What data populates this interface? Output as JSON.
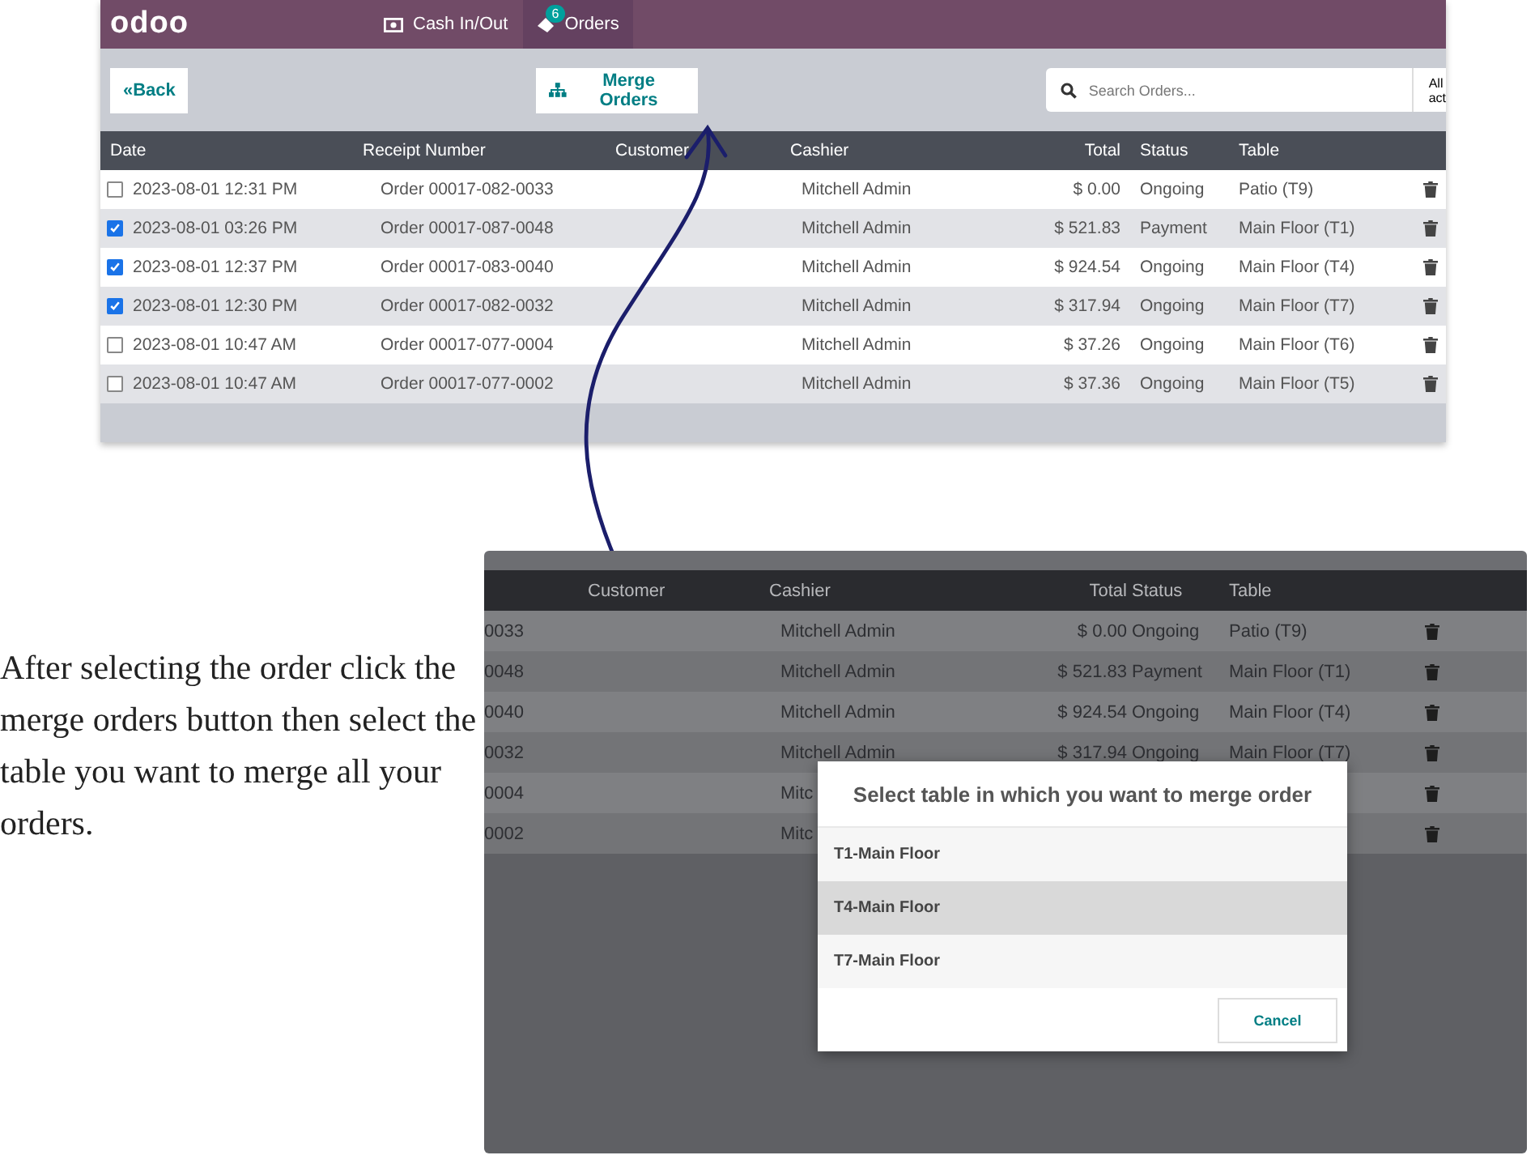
{
  "top_screenshot": {
    "brand": "odoo",
    "tabs": [
      {
        "kind": "cash",
        "label": "Cash In/Out",
        "selected": false
      },
      {
        "kind": "orders",
        "label": "Orders",
        "badge": "6",
        "selected": true
      }
    ],
    "back_button": {
      "icon": "«",
      "label": "Back"
    },
    "merge_button": "Merge Orders",
    "search": {
      "placeholder": "Search Orders...",
      "filter": "All act"
    },
    "columns": [
      "Date",
      "Receipt Number",
      "Customer",
      "Cashier",
      "Total",
      "Status",
      "Table"
    ],
    "rows": [
      {
        "checked": false,
        "date": "2023-08-01 12:31 PM",
        "receipt": "Order 00017-082-0033",
        "cashier": "Mitchell Admin",
        "total": "$ 0.00",
        "status": "Ongoing",
        "table": "Patio (T9)"
      },
      {
        "checked": true,
        "date": "2023-08-01 03:26 PM",
        "receipt": "Order 00017-087-0048",
        "cashier": "Mitchell Admin",
        "total": "$ 521.83",
        "status": "Payment",
        "table": "Main Floor (T1)"
      },
      {
        "checked": true,
        "date": "2023-08-01 12:37 PM",
        "receipt": "Order 00017-083-0040",
        "cashier": "Mitchell Admin",
        "total": "$ 924.54",
        "status": "Ongoing",
        "table": "Main Floor (T4)"
      },
      {
        "checked": true,
        "date": "2023-08-01 12:30 PM",
        "receipt": "Order 00017-082-0032",
        "cashier": "Mitchell Admin",
        "total": "$ 317.94",
        "status": "Ongoing",
        "table": "Main Floor (T7)"
      },
      {
        "checked": false,
        "date": "2023-08-01 10:47 AM",
        "receipt": "Order 00017-077-0004",
        "cashier": "Mitchell Admin",
        "total": "$ 37.26",
        "status": "Ongoing",
        "table": "Main Floor (T6)"
      },
      {
        "checked": false,
        "date": "2023-08-01 10:47 AM",
        "receipt": "Order 00017-077-0002",
        "cashier": "Mitchell Admin",
        "total": "$ 37.36",
        "status": "Ongoing",
        "table": "Main Floor (T5)"
      }
    ]
  },
  "caption": "After selecting the order click the merge orders button then select the table you want to merge all your orders.",
  "bottom_screenshot": {
    "columns": [
      "Customer",
      "Cashier",
      "Total",
      "Status",
      "Table"
    ],
    "rows": [
      {
        "receipt": "0033",
        "cashier": "Mitchell Admin",
        "total": "$ 0.00",
        "status": "Ongoing",
        "table": "Patio (T9)"
      },
      {
        "receipt": "0048",
        "cashier": "Mitchell Admin",
        "total": "$ 521.83",
        "status": "Payment",
        "table": "Main Floor (T1)"
      },
      {
        "receipt": "0040",
        "cashier": "Mitchell Admin",
        "total": "$ 924.54",
        "status": "Ongoing",
        "table": "Main Floor (T4)"
      },
      {
        "receipt": "0032",
        "cashier": "Mitchell Admin",
        "total": "$ 317.94",
        "status": "Ongoing",
        "table": "Main Floor (T7)"
      },
      {
        "receipt": "0004",
        "cashier": "Mitc"
      },
      {
        "receipt": "0002",
        "cashier": "Mitc"
      }
    ],
    "dialog": {
      "title": "Select table in which you want to merge order",
      "options": [
        {
          "label": "T1-Main Floor",
          "selected": false
        },
        {
          "label": "T4-Main Floor",
          "selected": true
        },
        {
          "label": "T7-Main Floor",
          "selected": false
        }
      ],
      "cancel": "Cancel"
    }
  }
}
